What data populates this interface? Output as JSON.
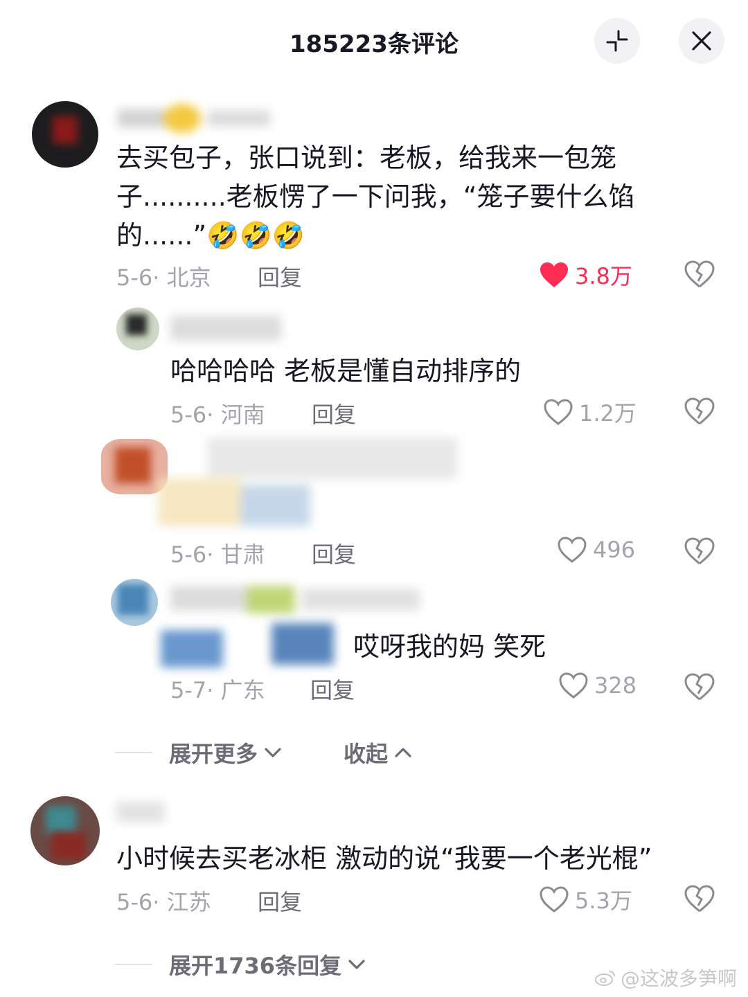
{
  "header": {
    "title": "185223条评论"
  },
  "comments": [
    {
      "text": "去买包子，张口说到：老板，给我来一包笼子..........老板愣了一下问我，“笼子要什么馅的......”🤣🤣🤣",
      "date_location": "5-6· 北京",
      "reply_label": "回复",
      "likes": "3.8万",
      "liked": true
    },
    {
      "text": "小时候去买老冰柜 激动的说“我要一个老光棍”",
      "date_location": "5-6· 江苏",
      "reply_label": "回复",
      "likes": "5.3万",
      "liked": false
    }
  ],
  "replies": [
    {
      "text": "哈哈哈哈  老板是懂自动排序的",
      "date_location": "5-6· 河南",
      "reply_label": "回复",
      "likes": "1.2万"
    },
    {
      "text": "",
      "date_location": "5-6· 甘肃",
      "reply_label": "回复",
      "likes": "496"
    },
    {
      "text": "哎呀我的妈 笑死",
      "date_location": "5-7· 广东",
      "reply_label": "回复",
      "likes": "328"
    }
  ],
  "thread_controls": {
    "expand_more": "展开更多",
    "collapse": "收起"
  },
  "expand_replies": "展开1736条回复",
  "watermark": "@这波多笋啊",
  "colors": {
    "liked": "#fe2c55",
    "text": "#161823",
    "meta": "#a3a4ab"
  }
}
